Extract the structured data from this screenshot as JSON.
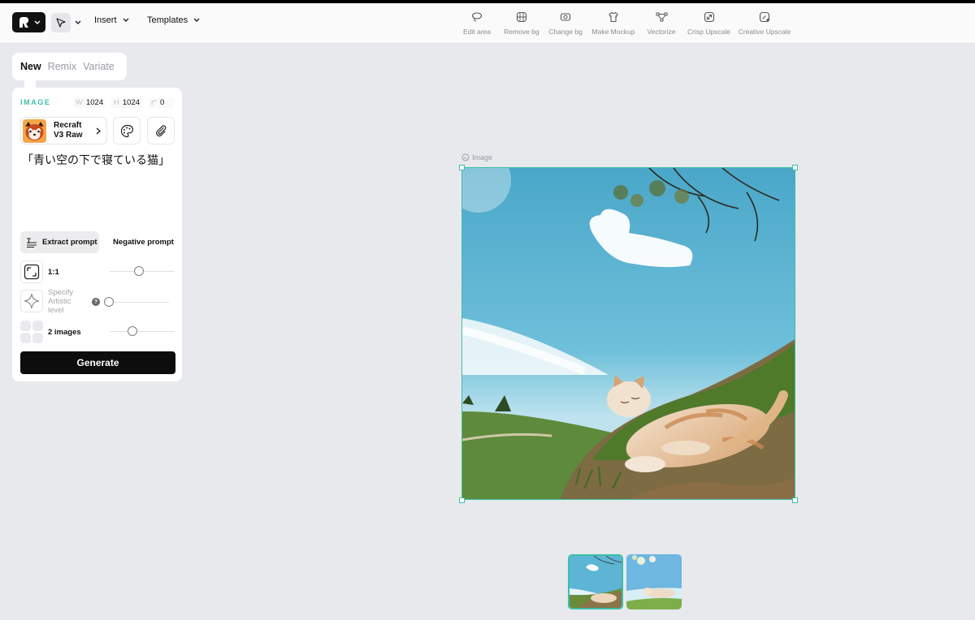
{
  "topbar": {
    "insert_label": "Insert",
    "templates_label": "Templates",
    "tools": [
      {
        "label": "Edit area",
        "icon": "lasso-icon"
      },
      {
        "label": "Remove bg",
        "icon": "remove-bg-icon"
      },
      {
        "label": "Change bg",
        "icon": "change-bg-icon"
      },
      {
        "label": "Make Mockup",
        "icon": "tshirt-icon"
      },
      {
        "label": "Vectorize",
        "icon": "vector-nodes-icon"
      },
      {
        "label": "Crisp Upscale",
        "icon": "upscale-icon"
      },
      {
        "label": "Creative Upscale",
        "icon": "sparkle-upscale-icon"
      }
    ]
  },
  "mode_tabs": {
    "new": "New",
    "remix": "Remix",
    "variate": "Variate",
    "active": "New"
  },
  "panel": {
    "section_label": "IMAGE",
    "width_key": "W",
    "width_value": "1024",
    "height_key": "H",
    "height_value": "1024",
    "rotation_value": "0",
    "model_name": "Recraft V3 Raw",
    "prompt": "「青い空の下で寝ている猫」",
    "extract_prompt_label": "Extract prompt",
    "negative_prompt_label": "Negative prompt",
    "aspect_label": "1:1",
    "artistic_label": "Specify Artistic level",
    "help_glyph": "?",
    "images_label": "2 images",
    "generate_label": "Generate"
  },
  "canvas": {
    "frame_label": "Image"
  },
  "colors": {
    "accent": "#3cbfa7",
    "dark": "#0d0d0d",
    "background": "#e8e9ed"
  }
}
